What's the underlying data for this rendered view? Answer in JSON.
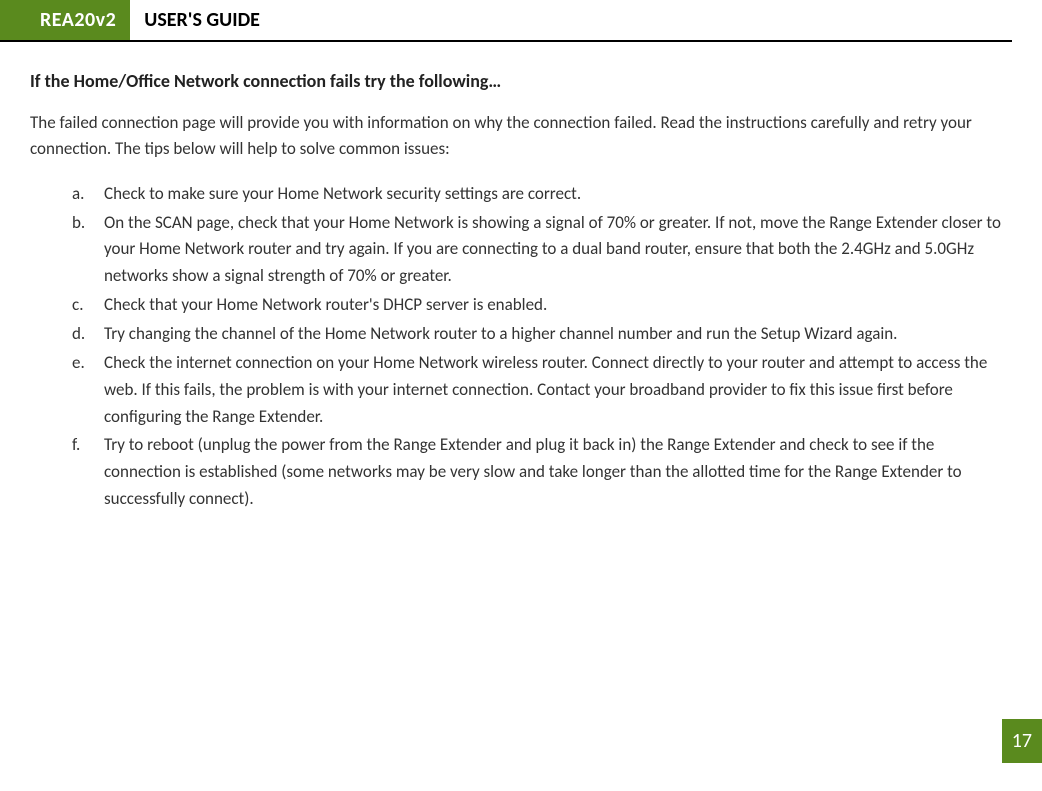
{
  "header": {
    "badge": "REA20v2",
    "title": "USER'S GUIDE"
  },
  "section": {
    "heading": "If the Home/Office Network connection fails try the following…",
    "intro": "The failed connection page will provide you with information on why the connection failed. Read the instructions carefully and retry your connection. The tips below will help to solve common issues:",
    "items": [
      {
        "marker": "a.",
        "text": "Check to make sure your Home Network security settings are correct."
      },
      {
        "marker": "b.",
        "text": "On the SCAN page, check that your Home Network is showing a signal of 70% or greater. If not, move the Range Extender closer to your Home Network router and try again. If you are connecting to a dual band router, ensure that both the 2.4GHz and 5.0GHz networks show a signal strength of 70% or greater."
      },
      {
        "marker": "c.",
        "text": "Check that your Home Network router's DHCP server is enabled."
      },
      {
        "marker": "d.",
        "text": "Try changing the channel of the Home Network router to a higher channel number and run the Setup Wizard again."
      },
      {
        "marker": "e.",
        "text": "Check the internet connection on your Home Network wireless router. Connect directly to your router and attempt to access the web.  If this fails, the problem is with your internet connection.  Contact your broadband provider to fix this issue first before configuring the Range Extender."
      },
      {
        "marker": "f.",
        "text": "Try to reboot (unplug the power from the Range Extender and plug it back in) the Range Extender and check to see if the connection is established (some networks may be very slow and take longer than the allotted time for the Range Extender to successfully connect)."
      }
    ]
  },
  "page_number": "17"
}
